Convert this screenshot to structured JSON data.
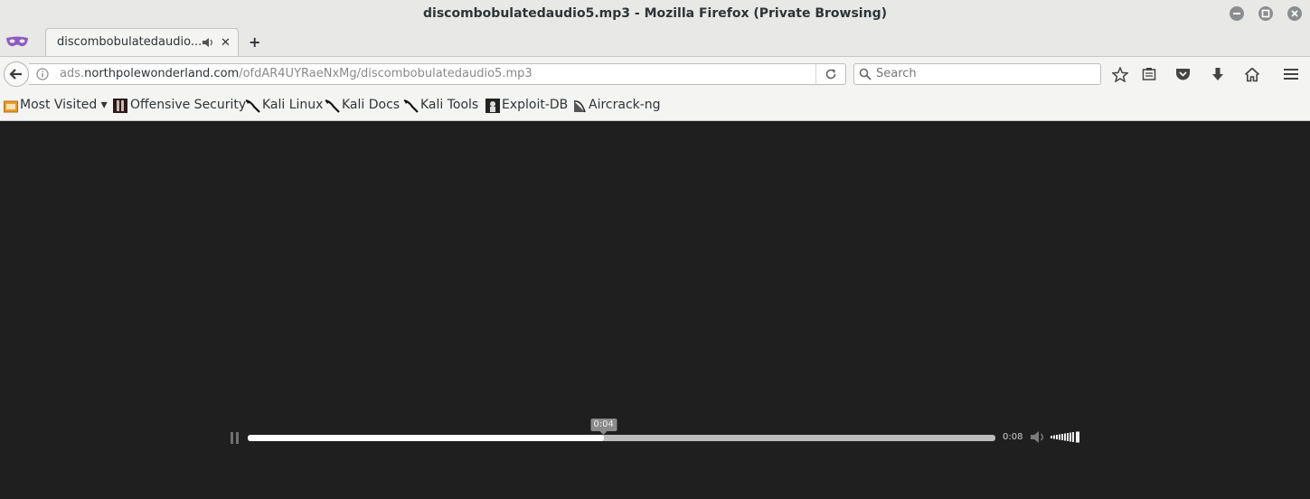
{
  "window": {
    "title": "discombobulatedaudio5.mp3 - Mozilla Firefox (Private Browsing)"
  },
  "tabs": [
    {
      "label": "discombobulatedaudio...",
      "audio_icon": "speaker-icon",
      "close": "✕"
    }
  ],
  "new_tab_label": "+",
  "navbar": {
    "url_prefix": "ads.",
    "url_domain": "northpolewonderland.com",
    "url_path": "/ofdAR4UYRaeNxMg/discombobulatedaudio5.mp3",
    "search_placeholder": "Search",
    "toolbar_icons": [
      "star-icon",
      "reading-list-icon",
      "pocket-icon",
      "download-icon",
      "home-icon",
      "menu-icon"
    ]
  },
  "bookmarks": [
    {
      "label": "Most Visited ▾",
      "icon": "most-visited-icon"
    },
    {
      "label": "Offensive Security",
      "icon": "offsec-icon"
    },
    {
      "label": "Kali Linux",
      "icon": "kali-icon"
    },
    {
      "label": "Kali Docs",
      "icon": "kali-icon"
    },
    {
      "label": "Kali Tools",
      "icon": "kali-icon"
    },
    {
      "label": "Exploit-DB",
      "icon": "exploitdb-icon"
    },
    {
      "label": "Aircrack-ng",
      "icon": "aircrack-icon"
    }
  ],
  "media": {
    "current_time": "0:04",
    "duration": "0:08",
    "progress": 0.476,
    "state": "playing",
    "volume_level": 1.0
  },
  "colors": {
    "background": "#1f1f1f",
    "chrome": "#e8e8e7",
    "track": "#bcbcbc",
    "track_fill": "#ffffff"
  }
}
